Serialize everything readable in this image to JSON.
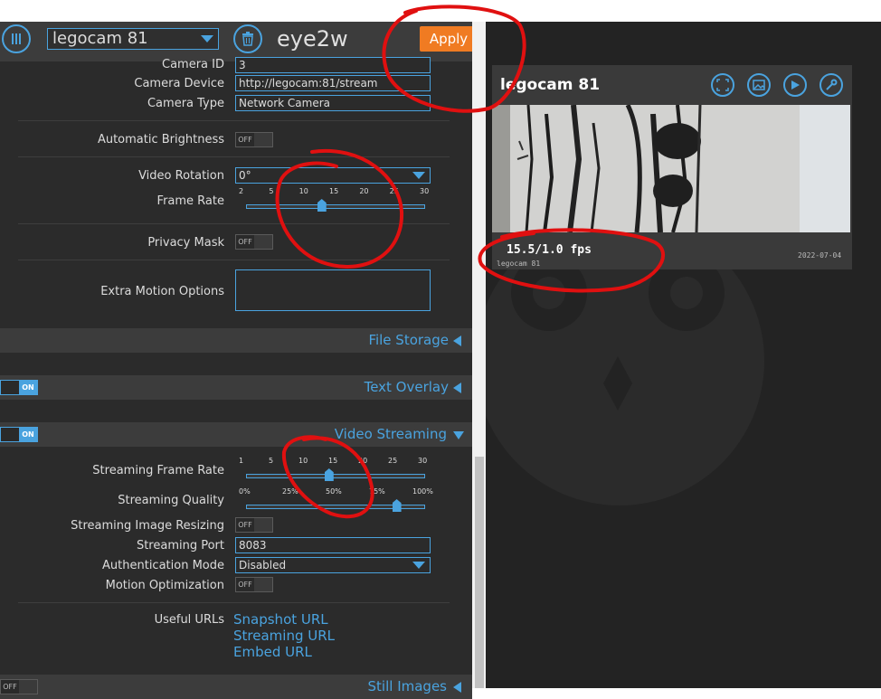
{
  "header": {
    "camera_select": "legocam 81",
    "app_title": "eye2w",
    "apply_label": "Apply"
  },
  "settings": {
    "camera_id_label": "Camera ID",
    "camera_id_value": "3",
    "camera_device_label": "Camera Device",
    "camera_device_value": "http://legocam:81/stream",
    "camera_type_label": "Camera Type",
    "camera_type_value": "Network Camera",
    "auto_brightness_label": "Automatic Brightness",
    "auto_brightness_state": "OFF",
    "video_rotation_label": "Video Rotation",
    "video_rotation_value": "0°",
    "frame_rate_label": "Frame Rate",
    "frame_rate_ticks": [
      "2",
      "5",
      "10",
      "15",
      "20",
      "25",
      "30"
    ],
    "frame_rate_value": 15,
    "privacy_mask_label": "Privacy Mask",
    "privacy_mask_state": "OFF",
    "extra_motion_label": "Extra Motion Options"
  },
  "sections": {
    "file_storage": "File Storage",
    "text_overlay": "Text Overlay",
    "text_overlay_state": "ON",
    "video_streaming": "Video Streaming",
    "video_streaming_state": "ON",
    "still_images": "Still Images",
    "still_images_state": "OFF"
  },
  "streaming": {
    "frame_rate_label": "Streaming Frame Rate",
    "frame_rate_ticks": [
      "1",
      "5",
      "10",
      "15",
      "20",
      "25",
      "30"
    ],
    "frame_rate_value": 15,
    "quality_label": "Streaming Quality",
    "quality_ticks": [
      "0%",
      "25%",
      "50%",
      "75%",
      "100%"
    ],
    "quality_value_percent": 85,
    "resizing_label": "Streaming Image Resizing",
    "resizing_state": "OFF",
    "port_label": "Streaming Port",
    "port_value": "8083",
    "auth_label": "Authentication Mode",
    "auth_value": "Disabled",
    "motion_opt_label": "Motion Optimization",
    "motion_opt_state": "OFF",
    "useful_urls_label": "Useful URLs",
    "snapshot_url": "Snapshot URL",
    "streaming_url": "Streaming URL",
    "embed_url": "Embed URL"
  },
  "camera_view": {
    "title": "legocam 81",
    "fps": "15.5/1.0 fps",
    "overlay_name": "legocam 81",
    "overlay_date": "2022-07-04"
  },
  "colors": {
    "accent": "#4aa3df",
    "apply": "#f07b22",
    "annotation": "#e01010"
  },
  "icons": {
    "menu": "menu-icon",
    "delete": "trash-icon",
    "fullscreen": "fullscreen-icon",
    "picture": "picture-icon",
    "play": "play-icon",
    "settings": "wrench-icon"
  }
}
